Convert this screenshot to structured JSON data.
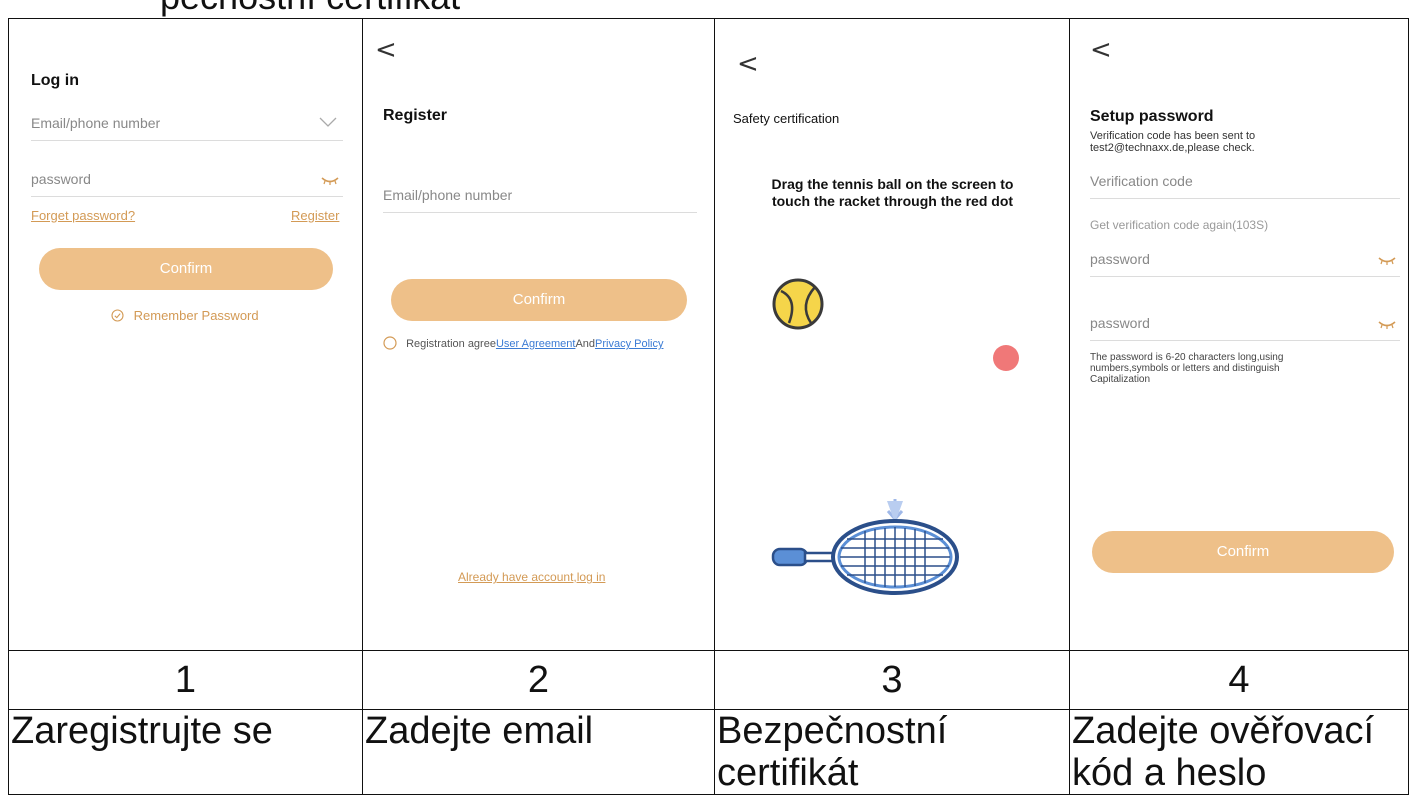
{
  "page": {
    "top_text": "pečnostní certifikát"
  },
  "columns": [
    {
      "number": "1",
      "caption": "Zaregistrujte se"
    },
    {
      "number": "2",
      "caption": "Zadejte email"
    },
    {
      "number": "3",
      "caption": "Bezpečnostní certifikát"
    },
    {
      "number": "4",
      "caption": "Zadejte ověřovací kód a heslo"
    }
  ],
  "screen1": {
    "title": "Log in",
    "email_placeholder": "Email/phone number",
    "password_placeholder": "password",
    "forget_link": "Forget password?",
    "register_link": "Register",
    "confirm": "Confirm",
    "remember": "Remember Password"
  },
  "screen2": {
    "back": "<",
    "title": "Register",
    "email_placeholder": "Email/phone number",
    "confirm": "Confirm",
    "agree_prefix": "Registration agree",
    "user_agreement": "User Agreement",
    "and_text": "And",
    "privacy_policy": "Privacy Policy",
    "login_link": "Already have account,log in"
  },
  "screen3": {
    "back": "<",
    "title": "Safety certification",
    "instruction_line1": "Drag the tennis ball on the screen to",
    "instruction_line2": "touch the racket through the red dot"
  },
  "screen4": {
    "back": "<",
    "title": "Setup password",
    "sent_line1": "Verification code has been sent to",
    "sent_line2": "test2@technaxx.de,please check.",
    "code_placeholder": "Verification code",
    "resend": "Get verification code again(103S)",
    "password1_placeholder": "password",
    "password2_placeholder": "password",
    "hint_line1": "The password is 6-20 characters long,using",
    "hint_line2": "numbers,symbols or letters and distinguish",
    "hint_line3": "Capitalization",
    "confirm": "Confirm"
  },
  "colors": {
    "accent": "#eec089",
    "accent_text": "#d39a55",
    "link_blue": "#3b7bd4",
    "ball": "#f5d54a",
    "red_dot": "#f07878",
    "racket": "#3d6fb8"
  }
}
